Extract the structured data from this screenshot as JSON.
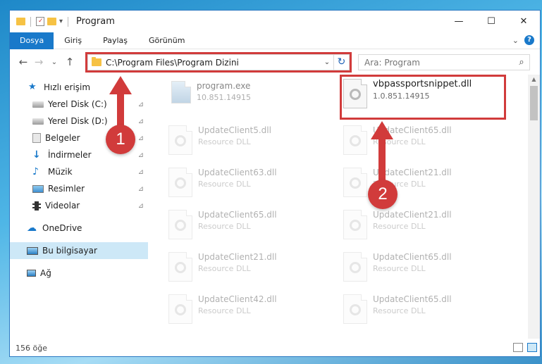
{
  "window": {
    "title": "Program",
    "controls": {
      "minimize": "—",
      "maximize": "☐",
      "close": "✕"
    }
  },
  "ribbon": {
    "tabs": [
      "Dosya",
      "Giriş",
      "Paylaş",
      "Görünüm"
    ],
    "expand_glyph": "⌄",
    "help_glyph": "?"
  },
  "navigation": {
    "back": "←",
    "forward": "→",
    "recent": "⌄",
    "up": "↑",
    "address": "C:\\Program Files\\Program Dizini",
    "address_dropdown": "⌄",
    "refresh": "↻"
  },
  "search": {
    "placeholder": "Ara: Program",
    "icon_glyph": "⌕"
  },
  "sidebar": {
    "items": [
      {
        "label": "Hızlı erişim",
        "icon": "star-icon",
        "pinned": false
      },
      {
        "label": "Yerel Disk (C:)",
        "icon": "drive-icon",
        "pinned": true
      },
      {
        "label": "Yerel Disk (D:)",
        "icon": "drive-icon",
        "pinned": true
      },
      {
        "label": "Belgeler",
        "icon": "documents-icon",
        "pinned": true
      },
      {
        "label": "İndirmeler",
        "icon": "download-icon",
        "pinned": true
      },
      {
        "label": "Müzik",
        "icon": "music-icon",
        "pinned": true
      },
      {
        "label": "Resimler",
        "icon": "pictures-icon",
        "pinned": true
      },
      {
        "label": "Videolar",
        "icon": "video-icon",
        "pinned": true
      },
      {
        "label": "OneDrive",
        "icon": "cloud-icon",
        "pinned": false
      },
      {
        "label": "Bu bilgisayar",
        "icon": "computer-icon",
        "pinned": false,
        "selected": true
      },
      {
        "label": "Ağ",
        "icon": "network-icon",
        "pinned": false
      }
    ],
    "pin_glyph": "📌"
  },
  "files": [
    {
      "name": "program.exe",
      "sub": "10.851.14915"
    },
    {
      "name": "vbpassportsnippet.dll",
      "sub": "1.0.851.14915"
    },
    {
      "name": "UpdateClient5.dll",
      "sub": "Resource DLL"
    },
    {
      "name": "UpdateClient65.dll",
      "sub": "Resource DLL"
    },
    {
      "name": "UpdateClient63.dll",
      "sub": "Resource DLL"
    },
    {
      "name": "UpdateClient21.dll",
      "sub": "Resource DLL"
    },
    {
      "name": "UpdateClient65.dll",
      "sub": "Resource DLL"
    },
    {
      "name": "UpdateClient21.dll",
      "sub": "Resource DLL"
    },
    {
      "name": "UpdateClient21.dll",
      "sub": "Resource DLL"
    },
    {
      "name": "UpdateClient65.dll",
      "sub": "Resource DLL"
    },
    {
      "name": "UpdateClient42.dll",
      "sub": "Resource DLL"
    },
    {
      "name": "UpdateClient65.dll",
      "sub": "Resource DLL"
    }
  ],
  "status": {
    "count": "156 öğe"
  },
  "annotations": {
    "badge1": "1",
    "badge2": "2"
  },
  "colors": {
    "accent": "#1979ca",
    "highlight": "#d13b3b",
    "selected": "#cde8f7"
  }
}
